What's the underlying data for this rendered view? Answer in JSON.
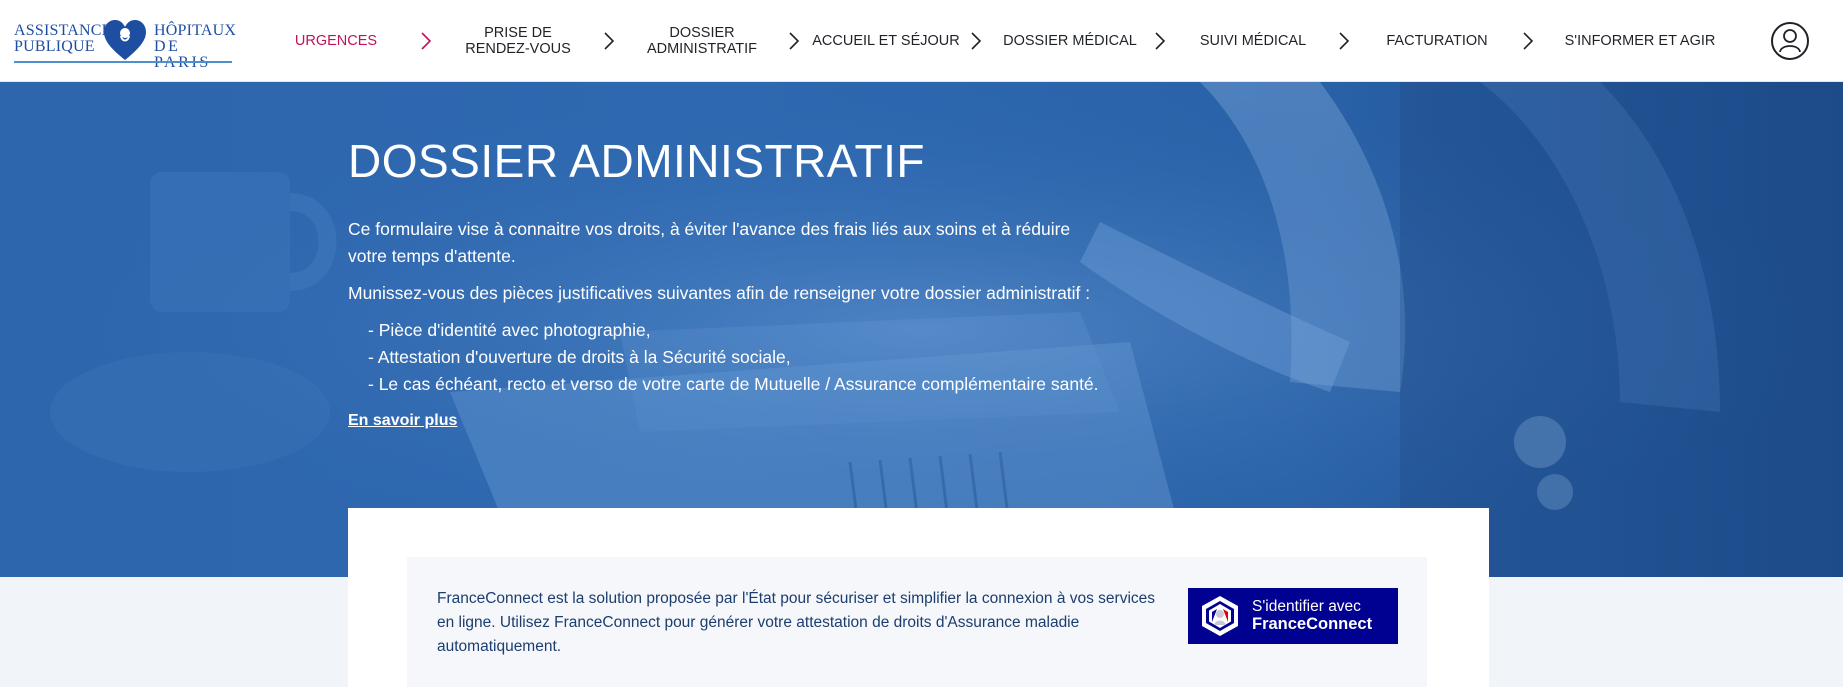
{
  "header": {
    "logo": {
      "left_line1": "ASSISTANCE",
      "left_line2": "PUBLIQUE",
      "right_line1": "HÔPITAUX",
      "right_line2": "DE PARIS"
    },
    "nav": [
      {
        "label": "URGENCES",
        "active": true
      },
      {
        "label": "PRISE DE\nRENDEZ-VOUS",
        "active": false
      },
      {
        "label": "DOSSIER\nADMINISTRATIF",
        "active": false
      },
      {
        "label": "ACCUEIL ET SÉJOUR",
        "active": false
      },
      {
        "label": "DOSSIER MÉDICAL",
        "active": false
      },
      {
        "label": "SUIVI MÉDICAL",
        "active": false
      },
      {
        "label": "FACTURATION",
        "active": false
      },
      {
        "label": "S'INFORMER ET AGIR",
        "active": false
      }
    ],
    "account_icon": "user-icon"
  },
  "hero": {
    "title": "DOSSIER ADMINISTRATIF",
    "paragraph1": "Ce formulaire vise à connaitre vos droits, à éviter l'avance des frais liés aux soins et à réduire votre temps d'attente.",
    "paragraph2": "Munissez-vous des pièces justificatives suivantes afin de renseigner votre dossier administratif :",
    "list": [
      "- Pièce d'identité avec photographie,",
      "- Attestation d'ouverture de droits à la Sécurité sociale,",
      "- Le cas échéant, recto et verso de votre carte de Mutuelle / Assurance complémentaire santé."
    ],
    "link": "En savoir plus"
  },
  "franceconnect": {
    "text": "FranceConnect est la solution proposée par l'État pour sécuriser et simplifier la connexion à vos services en ligne. Utilisez FranceConnect pour générer votre attestation de droits d'Assurance maladie automatiquement.",
    "button_line1": "S'identifier avec",
    "button_line2": "FranceConnect"
  },
  "colors": {
    "brand_blue": "#1d4ea2",
    "active_nav": "#c0125a",
    "hero_blue": "#2e66ad",
    "franceconnect_blue": "#000091"
  }
}
